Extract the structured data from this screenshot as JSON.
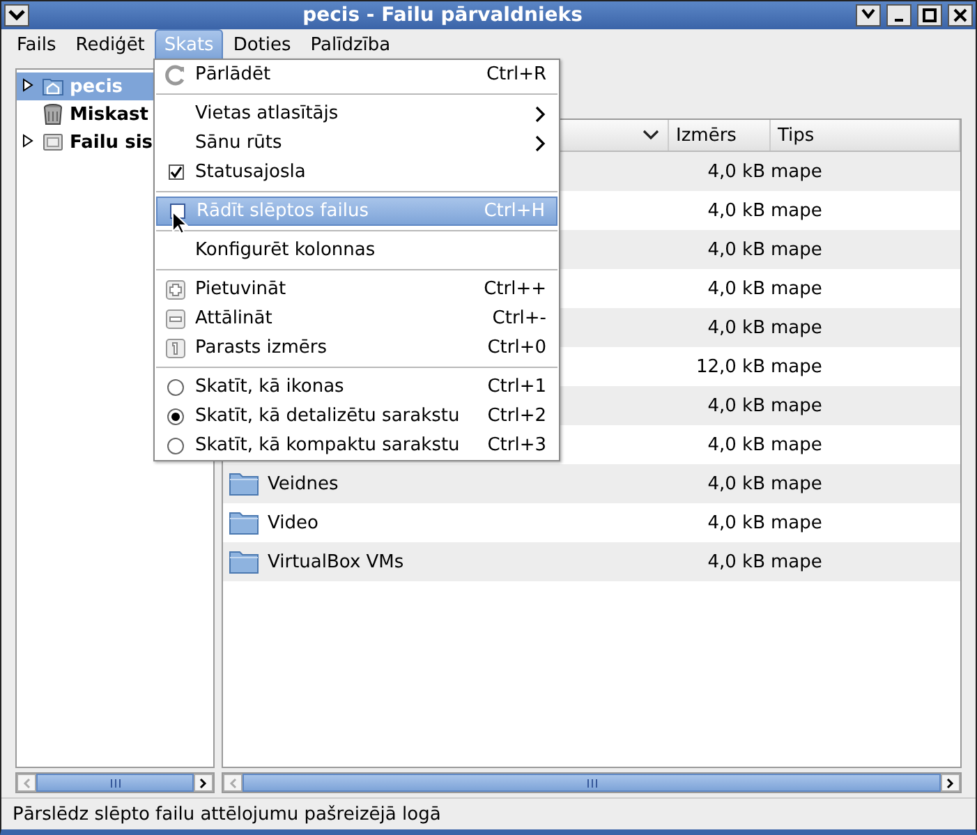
{
  "window": {
    "title": "pecis - Failu pārvaldnieks"
  },
  "menubar": [
    {
      "label": "Fails",
      "selected": false
    },
    {
      "label": "Rediģēt",
      "selected": false
    },
    {
      "label": "Skats",
      "selected": true
    },
    {
      "label": "Doties",
      "selected": false
    },
    {
      "label": "Palīdzība",
      "selected": false
    }
  ],
  "sidebar": {
    "items": [
      {
        "label": "pecis",
        "kind": "home",
        "expandable": true,
        "selected": true
      },
      {
        "label": "Miskast",
        "kind": "trash",
        "expandable": false,
        "selected": false
      },
      {
        "label": "Failu sis",
        "kind": "drive",
        "expandable": true,
        "selected": false
      }
    ]
  },
  "file_list": {
    "columns": [
      {
        "sorted": true
      },
      {
        "label": "Izmērs"
      },
      {
        "label": "Tips"
      }
    ],
    "rows": [
      {
        "size": "4,0 kB",
        "type": "mape"
      },
      {
        "size": "4,0 kB",
        "type": "mape"
      },
      {
        "size": "4,0 kB",
        "type": "mape"
      },
      {
        "size": "4,0 kB",
        "type": "mape"
      },
      {
        "size": "4,0 kB",
        "type": "mape"
      },
      {
        "size": "12,0 kB",
        "type": "mape"
      },
      {
        "size": "4,0 kB",
        "type": "mape"
      },
      {
        "size": "4,0 kB",
        "type": "mape"
      },
      {
        "name": "Veidnes",
        "size": "4,0 kB",
        "type": "mape"
      },
      {
        "name": "Video",
        "size": "4,0 kB",
        "type": "mape"
      },
      {
        "name": "VirtualBox VMs",
        "size": "4,0 kB",
        "type": "mape"
      }
    ]
  },
  "view_menu": [
    {
      "kind": "command",
      "label": "Pārlādēt",
      "shortcut": "Ctrl+R",
      "highlighted": false
    },
    {
      "kind": "separator"
    },
    {
      "kind": "submenu",
      "label": "Vietas atlasītājs",
      "highlighted": false
    },
    {
      "kind": "submenu",
      "label": "Sānu rūts",
      "highlighted": false
    },
    {
      "kind": "check",
      "label": "Statusajosla",
      "checked": true,
      "highlighted": false
    },
    {
      "kind": "separator"
    },
    {
      "kind": "check",
      "label": "Rādīt slēptos failus",
      "shortcut": "Ctrl+H",
      "checked": false,
      "highlighted": true
    },
    {
      "kind": "separator"
    },
    {
      "kind": "command",
      "label": "Konfigurēt kolonnas",
      "highlighted": false
    },
    {
      "kind": "separator"
    },
    {
      "kind": "command",
      "label": "Pietuvināt",
      "shortcut": "Ctrl++",
      "highlighted": false
    },
    {
      "kind": "command",
      "label": "Attālināt",
      "shortcut": "Ctrl+-",
      "highlighted": false
    },
    {
      "kind": "command",
      "label": "Parasts izmērs",
      "shortcut": "Ctrl+0",
      "highlighted": false
    },
    {
      "kind": "separator"
    },
    {
      "kind": "radio",
      "label": "Skatīt, kā ikonas",
      "shortcut": "Ctrl+1",
      "selected": false,
      "highlighted": false
    },
    {
      "kind": "radio",
      "label": "Skatīt, kā detalizētu sarakstu",
      "shortcut": "Ctrl+2",
      "selected": true,
      "highlighted": false
    },
    {
      "kind": "radio",
      "label": "Skatīt, kā kompaktu sarakstu",
      "shortcut": "Ctrl+3",
      "selected": false,
      "highlighted": false
    }
  ],
  "status_bar": {
    "text": "Pārslēdz slēpto failu attēlojumu pašreizējā logā"
  }
}
